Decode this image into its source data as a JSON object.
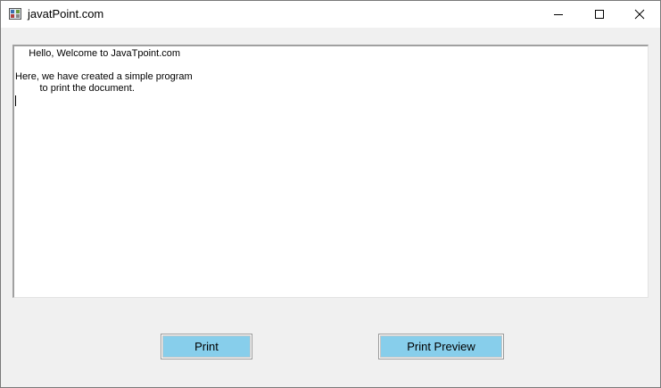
{
  "window": {
    "title": "javatPoint.com",
    "icon": "form-app-icon"
  },
  "controls": {
    "minimize_icon": "minimize-icon",
    "maximize_icon": "maximize-icon",
    "close_icon": "close-icon"
  },
  "document": {
    "lines": [
      "     Hello, Welcome to JavaTpoint.com",
      "",
      "Here, we have created a simple program",
      "         to print the document."
    ]
  },
  "buttons": {
    "print": "Print",
    "print_preview": "Print Preview"
  },
  "colors": {
    "button_bg": "#87ceeb",
    "form_bg": "#f0f0f0"
  }
}
